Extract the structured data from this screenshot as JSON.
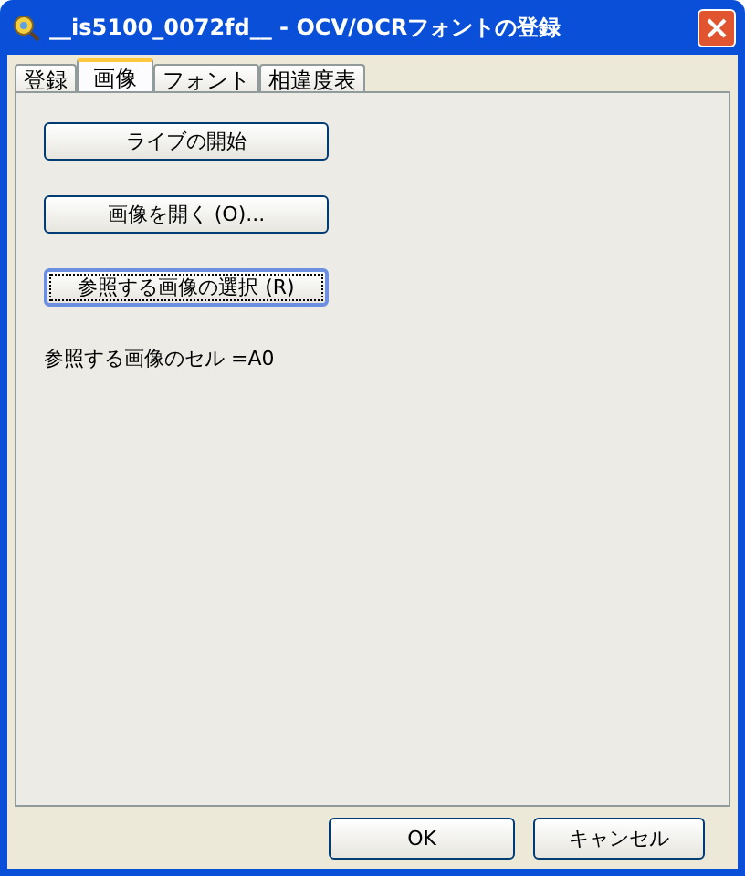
{
  "window": {
    "title": "__is5100_0072fd__ - OCV/OCRフォントの登録"
  },
  "tabs": [
    {
      "label": "登録",
      "selected": false
    },
    {
      "label": "画像",
      "selected": true
    },
    {
      "label": "フォント",
      "selected": false
    },
    {
      "label": "相違度表",
      "selected": false
    }
  ],
  "panel": {
    "buttons": [
      {
        "label": "ライブの開始",
        "focused": false
      },
      {
        "label": "画像を開く (O)...",
        "focused": false
      },
      {
        "label": "参照する画像の選択 (R)",
        "focused": true
      }
    ],
    "cell_label": "参照する画像のセル =A0"
  },
  "footer_buttons": [
    "OK",
    "キャンセル"
  ]
}
